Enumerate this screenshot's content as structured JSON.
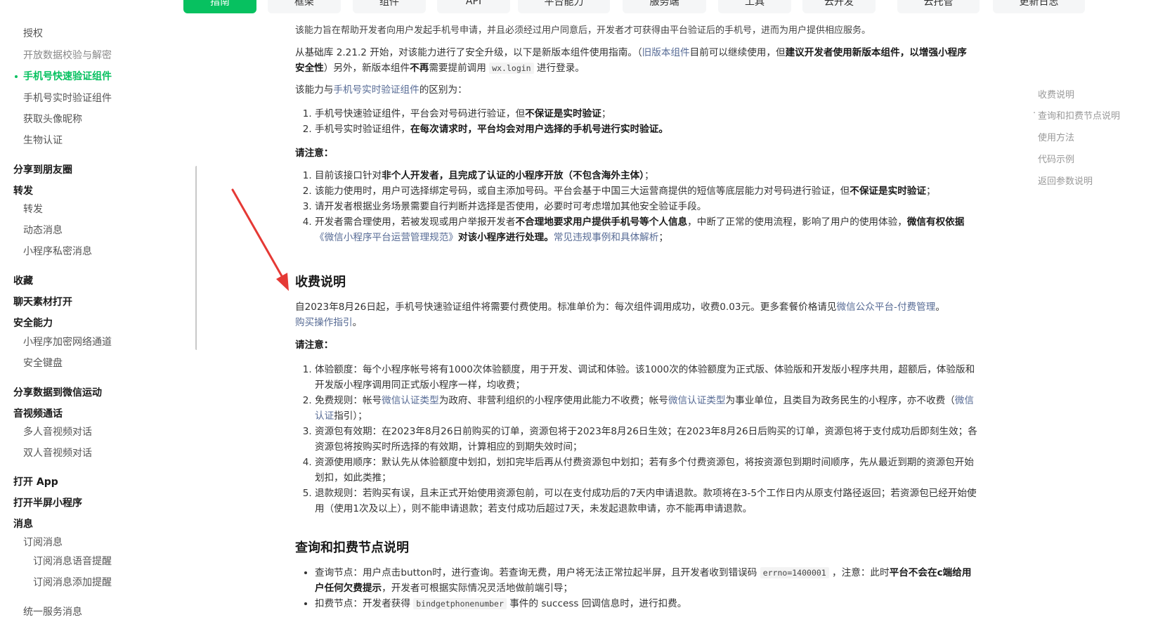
{
  "topnav": {
    "tabs": [
      {
        "label": "指南",
        "active": true
      },
      {
        "label": "框架",
        "active": false
      },
      {
        "label": "组件",
        "active": false
      },
      {
        "label": "API",
        "active": false
      },
      {
        "label": "平台能力",
        "active": false
      },
      {
        "label": "服务端",
        "active": false
      },
      {
        "label": "工具",
        "active": false
      },
      {
        "label": "云开发",
        "active": false
      },
      {
        "label": "云托管",
        "active": false
      },
      {
        "label": "更新日志",
        "active": false
      }
    ]
  },
  "sidebar": {
    "items": [
      {
        "label": "授权",
        "level": 1
      },
      {
        "label": "开放数据校验与解密",
        "level": 1,
        "muted": true
      },
      {
        "label": "手机号快速验证组件",
        "level": 1,
        "active": true
      },
      {
        "label": "手机号实时验证组件",
        "level": 1
      },
      {
        "label": "获取头像昵称",
        "level": 1
      },
      {
        "label": "生物认证",
        "level": 1
      },
      {
        "label": "分享到朋友圈",
        "level": 0
      },
      {
        "label": "转发",
        "level": 0
      },
      {
        "label": "转发",
        "level": 1
      },
      {
        "label": "动态消息",
        "level": 1
      },
      {
        "label": "小程序私密消息",
        "level": 1
      },
      {
        "label": "收藏",
        "level": 0
      },
      {
        "label": "聊天素材打开",
        "level": 0
      },
      {
        "label": "安全能力",
        "level": 0
      },
      {
        "label": "小程序加密网络通道",
        "level": 1
      },
      {
        "label": "安全键盘",
        "level": 1
      },
      {
        "label": "分享数据到微信运动",
        "level": 0
      },
      {
        "label": "音视频通话",
        "level": 0
      },
      {
        "label": "多人音视频对话",
        "level": 1
      },
      {
        "label": "双人音视频对话",
        "level": 1
      },
      {
        "label": "打开 App",
        "level": 0
      },
      {
        "label": "打开半屏小程序",
        "level": 0
      },
      {
        "label": "消息",
        "level": 0
      },
      {
        "label": "订阅消息",
        "level": 1
      },
      {
        "label": "订阅消息语音提醒",
        "level": 2
      },
      {
        "label": "订阅消息添加提醒",
        "level": 2
      },
      {
        "label": "统一服务消息",
        "level": 1
      }
    ]
  },
  "content": {
    "intro_line": "该能力旨在帮助开发者向用户发起手机号申请，并且必须经过用户同意后，开发者才可获得由平台验证后的手机号，进而为用户提供相应服务。",
    "p1_a": "从基础库 2.21.2 开始，对该能力进行了安全升级，以下是新版本组件使用指南。（",
    "p1_link": "旧版本组件",
    "p1_b": "目前可以继续使用，但",
    "p1_bold": "建议开发者使用新版本组件，以增强小程序安全性",
    "p1_c": "）另外，新版本组件",
    "p1_bold2": "不再",
    "p1_d": "需要提前调用",
    "p1_code": "wx.login",
    "p1_e": "进行登录。",
    "p2_a": "该能力与",
    "p2_link": "手机号实时验证组件",
    "p2_b": "的区别为：",
    "diff": [
      {
        "a": "手机号快速验证组件，平台会对号码进行验证，但",
        "bold": "不保证是实时验证",
        "b": "；"
      },
      {
        "a": "手机号实时验证组件，",
        "bold": "在每次请求时，平台均会对用户选择的手机号进行实时验证。",
        "b": ""
      }
    ],
    "note_label": "请注意：",
    "notes1": [
      {
        "a": "目前该接口针对",
        "bold": "非个人开发者，且完成了认证的小程序开放（不包含海外主体）",
        "b": "；"
      },
      {
        "a": "该能力使用时，用户可选择绑定号码，或自主添加号码。平台会基于中国三大运营商提供的短信等底层能力对号码进行验证，但",
        "bold": "不保证是实时验证",
        "b": "；"
      },
      {
        "a": "请开发者根据业务场景需要自行判断并选择是否使用，必要时可考虑增加其他安全验证手段。",
        "bold": "",
        "b": ""
      },
      {
        "a": "开发者需合理使用，若被发现或用户举报开发者",
        "bold": "不合理地要求用户提供手机号等个人信息",
        "b": "，中断了正常的使用流程，影响了用户的使用体验，",
        "bold2": "微信有权依据",
        "link": "《微信小程序平台运营管理规范》",
        "bold3": "对该小程序进行处理。",
        "link2": "常见违规事例和具体解析",
        "c": "；"
      }
    ],
    "fee_title": "收费说明",
    "fee_p_a": "自2023年8月26日起，手机号快速验证组件将需要付费使用。标准单价为：每次组件调用成功，收费0.03元。更多套餐价格请见",
    "fee_p_link": "微信公众平台-付费管理",
    "fee_p_b": "。",
    "fee_p_link2": "购买操作指引",
    "fee_p_c": "。",
    "fee_notes": [
      {
        "a": "体验额度：每个小程序帐号将有1000次体验额度，用于开发、调试和体验。该1000次的体验额度为正式版、体验版和开发版小程序共用，超额后，体验版和开发版小程序调用同正式版小程序一样，均收费；"
      },
      {
        "a": "免费规则：帐号",
        "link": "微信认证类型",
        "b": "为政府、非营利组织的小程序使用此能力不收费；帐号",
        "link2": "微信认证类型",
        "c": "为事业单位，且类目为政务民生的小程序，亦不收费（",
        "link3": "微信认证",
        "d": "指引）；"
      },
      {
        "a": "资源包有效期：在2023年8月26日前购买的订单，资源包将于2023年8月26日生效；在2023年8月26日后购买的订单，资源包将于支付成功后即刻生效；各资源包将按购买时所选择的有效期，计算相应的到期失效时间；"
      },
      {
        "a": "资源使用顺序：默认先从体验额度中划扣，划扣完毕后再从付费资源包中划扣；若有多个付费资源包，将按资源包到期时间顺序，先从最近到期的资源包开始划扣，如此类推；"
      },
      {
        "a": "退款规则：若购买有误，且未正式开始使用资源包前，可以在支付成功后的7天内申请退款。款项将在3-5个工作日内从原支付路径返回；若资源包已经开始使用（使用1次及以上），则不能申请退款；若支付成功后超过7天，未发起退款申请，亦不能再申请退款。"
      }
    ],
    "query_title": "查询和扣费节点说明",
    "query_items": [
      {
        "a": "查询节点：用户点击button时，进行查询。若查询无费，用户将无法正常拉起半屏，且开发者收到错误码",
        "code": "errno=1400001",
        "b": "，注意：此时",
        "bold": "平台不会在c端给用户任何欠费提示",
        "c": "，开发者可根据实际情况灵活地做前端引导；"
      },
      {
        "a": "扣费节点：开发者获得",
        "code": "bindgetphonenumber",
        "b": "事件的 success 回调信息时，进行扣费。"
      }
    ]
  },
  "toc": {
    "items": [
      {
        "label": "收费说明",
        "current": false
      },
      {
        "label": "查询和扣费节点说明",
        "current": true
      },
      {
        "label": "使用方法",
        "current": false
      },
      {
        "label": "代码示例",
        "current": false
      },
      {
        "label": "返回参数说明",
        "current": false
      }
    ]
  },
  "colors": {
    "brand": "#07c160",
    "link": "#576b95",
    "arrow": "#e53935"
  }
}
